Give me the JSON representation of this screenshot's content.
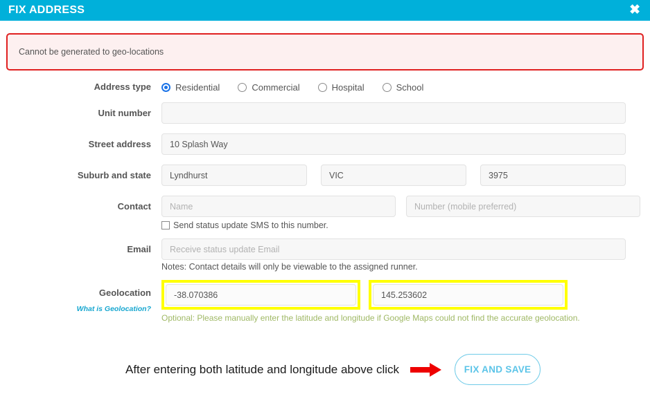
{
  "header": {
    "title": "FIX ADDRESS",
    "close_label": "✖"
  },
  "alert": {
    "message": "Cannot be generated to geo-locations"
  },
  "form": {
    "address_type": {
      "label": "Address type",
      "options": [
        {
          "label": "Residential",
          "selected": true
        },
        {
          "label": "Commercial",
          "selected": false
        },
        {
          "label": "Hospital",
          "selected": false
        },
        {
          "label": "School",
          "selected": false
        }
      ]
    },
    "unit_number": {
      "label": "Unit number",
      "value": "",
      "placeholder": ""
    },
    "street_address": {
      "label": "Street address",
      "value": "10 Splash Way",
      "placeholder": ""
    },
    "suburb_and_state": {
      "label": "Suburb and state",
      "suburb_value": "Lyndhurst",
      "state_value": "VIC",
      "postcode_value": "3975"
    },
    "contact": {
      "label": "Contact",
      "name_placeholder": "Name",
      "name_value": "",
      "number_placeholder": "Number (mobile preferred)",
      "number_value": "",
      "sms_checkbox_label": "Send status update SMS to this number.",
      "sms_checked": false
    },
    "email": {
      "label": "Email",
      "placeholder": "Receive status update Email",
      "value": "",
      "note": "Notes: Contact details will only be viewable to the assigned runner."
    },
    "geolocation": {
      "label": "Geolocation",
      "help_link": "What is Geolocation?",
      "latitude_value": "-38.070386",
      "longitude_value": "145.253602",
      "note": "Optional: Please manually enter the latitude and longitude if Google Maps could not find the accurate geolocation."
    }
  },
  "cta": {
    "instruction": "After entering both latitude and longitude above click",
    "arrow_icon": "right-arrow-icon",
    "button_label": "FIX AND SAVE"
  },
  "colors": {
    "header_bg": "#00b0da",
    "alert_border": "#e02020",
    "alert_bg": "#fdf0f0",
    "highlight": "#ffff00",
    "arrow": "#ee0000",
    "button_accent": "#5bc4e8",
    "link": "#18a7d0",
    "note_green": "#9fb865"
  }
}
